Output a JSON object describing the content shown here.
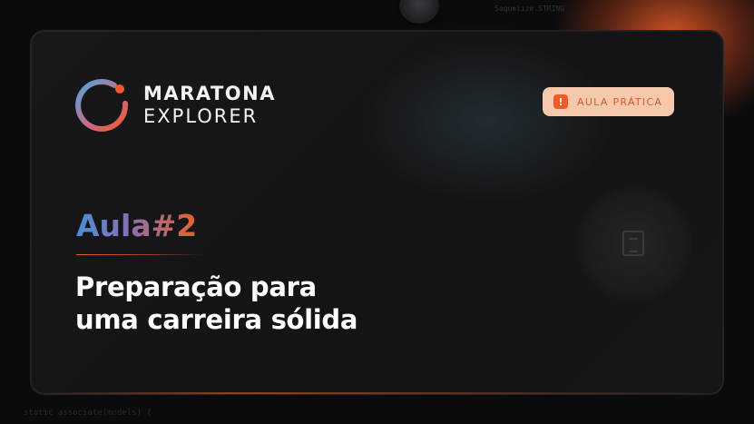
{
  "background": {
    "code_bottom": "static associate(models) {",
    "code_top": "Sequelize.STRING"
  },
  "brand": {
    "line1": "MARATONA",
    "line2": "EXPLORER",
    "colors": {
      "ring_start": "#4aa8e0",
      "ring_end": "#f05a28",
      "dot": "#f05a28"
    }
  },
  "badge": {
    "icon": "alert-icon",
    "icon_glyph": "!",
    "label": "AULA PRÁTICA",
    "colors": {
      "background": "#f6c9ad",
      "text": "#e2572a",
      "icon_bg": "#f05a28"
    }
  },
  "lesson": {
    "label": "Aula#2"
  },
  "title": {
    "line1": "Preparação para",
    "line2": "uma carreira sólida"
  },
  "colors": {
    "page_bg": "#0b0b0d",
    "card_bg": "#161618",
    "accent_orange": "#e8602c",
    "accent_blue": "#4a8fd6"
  }
}
